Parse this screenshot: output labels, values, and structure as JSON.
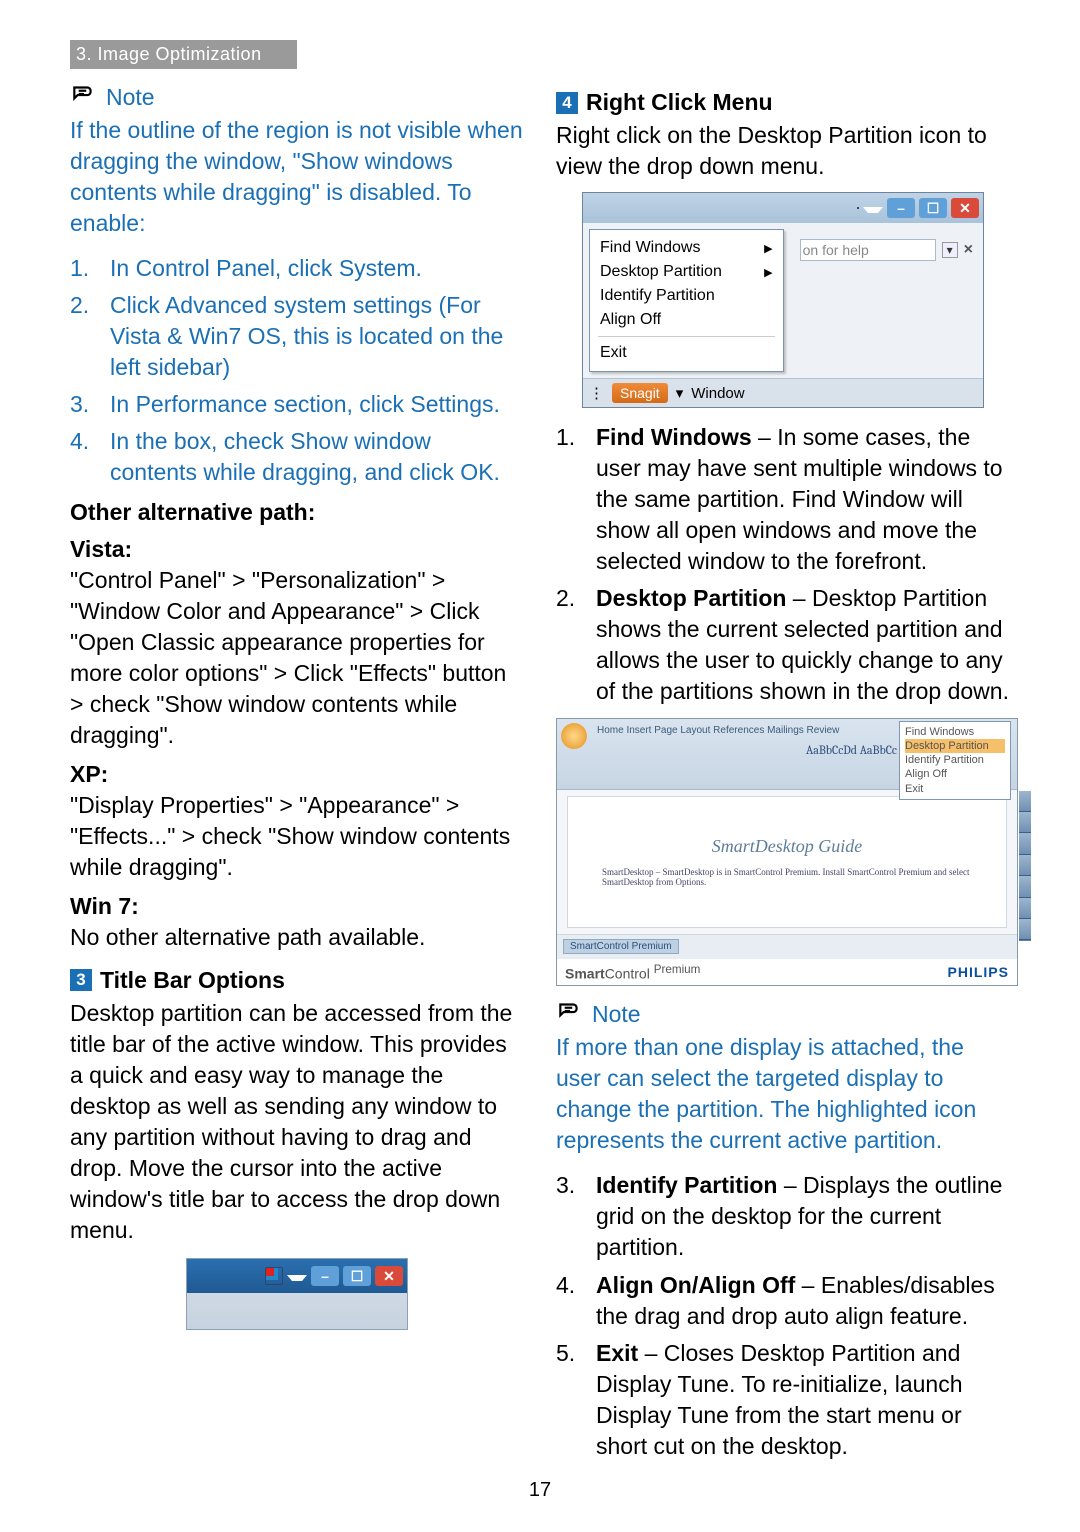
{
  "header": {
    "title": "3. Image Optimization"
  },
  "left": {
    "note_label": "Note",
    "note_body": "If the outline of the region is not visible when dragging the window, \"Show windows contents while dragging\" is disabled. To enable:",
    "note_steps": [
      "In Control Panel, click System.",
      "Click Advanced system settings (For Vista & Win7 OS, this is located on the left sidebar)",
      "In Performance section, click Settings.",
      "In the box, check Show window contents while dragging, and click OK."
    ],
    "alt_title": "Other alternative path:",
    "vista_h": "Vista:",
    "vista_p": "\"Control Panel\" > \"Personalization\" > \"Window Color and Appearance\" > Click \"Open Classic appearance properties for more color options\" > Click \"Effects\" button > check \"Show window contents while dragging\".",
    "xp_h": "XP:",
    "xp_p": "\"Display Properties\" > \"Appearance\" > \"Effects...\" > check \"Show window contents while dragging\".",
    "win7_h": "Win 7:",
    "win7_p": "No other alternative path available.",
    "sec3_num": "3",
    "sec3_title": "Title Bar Options",
    "sec3_p": "Desktop partition can be accessed from the title bar of the active window. This provides a quick and easy way to manage the desktop as well as sending any window to any partition without having to drag and drop. Move the cursor into the active window's title bar to access the drop down menu."
  },
  "right": {
    "sec4_num": "4",
    "sec4_title": "Right Click Menu",
    "sec4_p": "Right click on the Desktop Partition icon to view the drop down menu.",
    "menu": {
      "items": [
        "Find Windows",
        "Desktop Partition",
        "Identify Partition",
        "Align Off",
        "Exit"
      ],
      "help_placeholder": "on for help",
      "snagit": "Snagit",
      "window": "Window"
    },
    "list4": [
      {
        "lead": "Find Windows",
        "rest": " – In some cases, the user may have sent multiple windows to the same partition. Find Window will show all open windows and move the selected window to the forefront."
      },
      {
        "lead": "Desktop Partition",
        "rest": " – Desktop Partition shows the current selected partition and allows the user to quickly change to any of the partitions shown in the drop down."
      }
    ],
    "partfig": {
      "tabs": "Home    Insert    Page Layout    References    Mailings    Review",
      "styles": "AaBbCcDd  AaBbCc",
      "cm": [
        "Find Windows",
        "Desktop Partition",
        "Identify Partition",
        "Align Off",
        "Exit"
      ],
      "doc_title": "SmartDesktop Guide",
      "doc_sub": "SmartDesktop – SmartDesktop is in SmartControl Premium.  Install SmartControl Premium and select SmartDesktop from Options.",
      "chip": "SmartControl Premium",
      "logo_a": "Smart",
      "logo_b": "Control ",
      "logo_c": "Premium",
      "philips": "PHILIPS"
    },
    "note_label": "Note",
    "note_body": "If more than one display is attached, the user can select the targeted display to change the partition. The highlighted icon represents the current active partition.",
    "list_rest": [
      {
        "lead": "Identify Partition",
        "rest": " – Displays the outline grid on the desktop for the current partition."
      },
      {
        "lead": "Align On/Align Off",
        "rest": " – Enables/disables the drag and drop auto align feature."
      },
      {
        "lead": "Exit",
        "rest": " – Closes Desktop Partition and Display Tune. To re-initialize, launch Display Tune from the start menu or short cut on the desktop."
      }
    ]
  },
  "page_number": "17"
}
